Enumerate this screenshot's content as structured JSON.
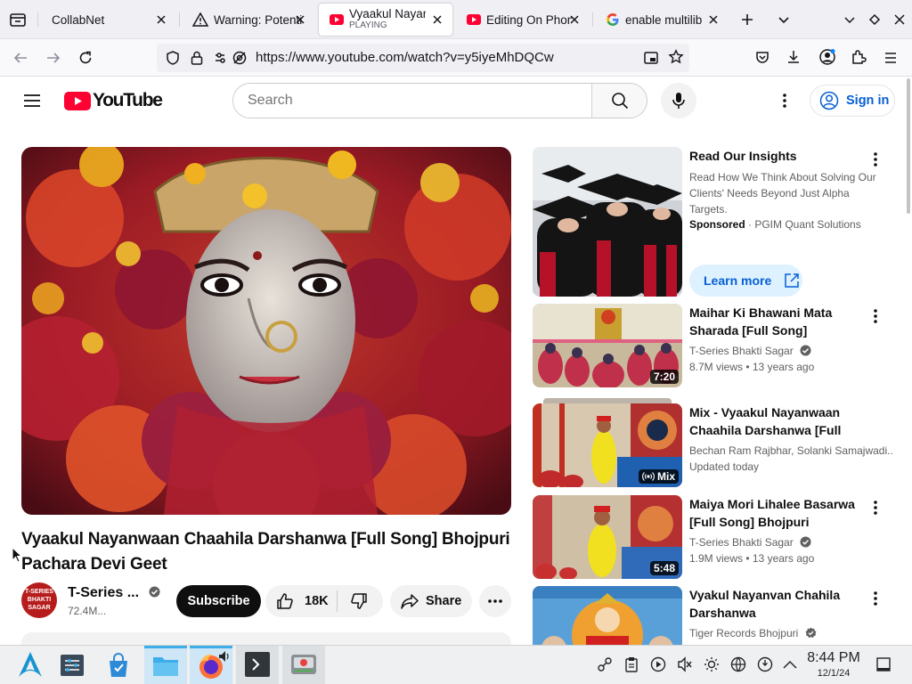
{
  "browser": {
    "tabs": [
      {
        "label": "CollabNet"
      },
      {
        "label": "Warning: Potential Security Risk Ahead"
      },
      {
        "label": "Vyaakul Nayanwaan Chaahila Darshanwa",
        "status": "PLAYING"
      },
      {
        "label": "Editing On Phone"
      },
      {
        "label": "enable multilib"
      }
    ],
    "url": "https://www.youtube.com/watch?v=y5iyeMhDQCw"
  },
  "youtube": {
    "logo": "YouTube",
    "search_placeholder": "Search",
    "signin": "Sign in"
  },
  "video": {
    "title": "Vyaakul Nayanwaan Chaahila Darshanwa [Full Song] Bhojpuri Pachara Devi Geet",
    "channel": "T-Series ...",
    "channel_avatar_text": "T-SERIES BHAKTI SAGAR",
    "subscribers": "72.4M...",
    "subscribe": "Subscribe",
    "likes": "18K",
    "share": "Share"
  },
  "sidebar": {
    "ad": {
      "title": "Read Our Insights",
      "description": "Read How We Think About Solving Our Clients' Needs Beyond Just Alpha Targets.",
      "sponsored": "Sponsored",
      "advertiser": "PGIM Quant Solutions",
      "cta": "Learn more"
    },
    "items": [
      {
        "title": "Maihar Ki Bhawani Mata Sharada [Full Song] Bhojpuri...",
        "channel": "T-Series Bhakti Sagar",
        "meta": "8.7M views • 13 years ago",
        "duration": "7:20"
      },
      {
        "title": "Mix - Vyaakul Nayanwaan Chaahila Darshanwa [Full Son...",
        "channel": "Bechan Ram Rajbhar, Solanki Samajwadi...",
        "meta": "Updated today",
        "duration": "Mix"
      },
      {
        "title": "Maiya Mori Lihalee Basarwa [Full Song] Bhojpuri Pachara...",
        "channel": "T-Series Bhakti Sagar",
        "meta": "1.9M views • 13 years ago",
        "duration": "5:48"
      },
      {
        "title": "Vyakul Nayanvan Chahila Darshanwa",
        "channel": "Tiger Records Bhojpuri",
        "meta": "",
        "duration": ""
      }
    ]
  },
  "taskbar": {
    "time": "8:44 PM",
    "date": "12/1/24"
  },
  "colors": {
    "yt_red": "#ff0033",
    "link_blue": "#065fd4",
    "taskbar": "#eff0f1"
  }
}
